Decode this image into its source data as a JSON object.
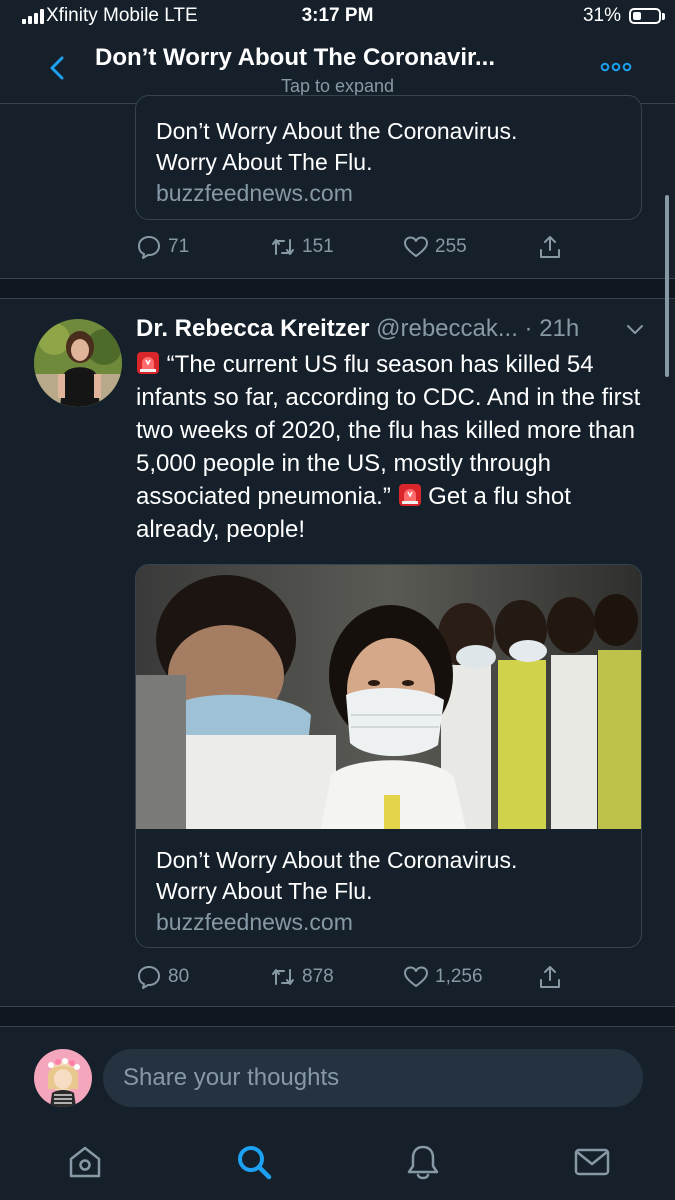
{
  "status_bar": {
    "carrier": "Xfinity Mobile  LTE",
    "time": "3:17 PM",
    "battery": "31%",
    "battery_level": 0.31
  },
  "header": {
    "title": "Don’t Worry About The Coronavir...",
    "subtitle": "Tap to expand",
    "back_icon": "chevron-left-icon",
    "more_icon": "more-dots-icon"
  },
  "top_tweet": {
    "card": {
      "title_line1": "Don’t Worry About the Coronavirus.",
      "title_line2": "Worry About The Flu.",
      "domain": "buzzfeednews.com"
    },
    "actions": {
      "replies": "71",
      "retweets": "151",
      "likes": "255"
    }
  },
  "tweet": {
    "author": "Dr. Rebecca Kreitzer",
    "handle": "@rebeccak...",
    "time": "· 21h",
    "text_part1": "“The current US flu season has killed 54 infants so far, according to CDC. And in the first two weeks of 2020, the flu has killed more than 5,000 people in the US, mostly through associated pneumonia.”",
    "text_part2": "Get a flu shot already, people!",
    "card": {
      "title_line1": "Don’t Worry About the Coronavirus.",
      "title_line2": "Worry About The Flu.",
      "domain": "buzzfeednews.com"
    },
    "actions": {
      "replies": "80",
      "retweets": "878",
      "likes": "1,256"
    }
  },
  "composer": {
    "placeholder": "Share your thoughts"
  },
  "tabs": [
    "home-icon",
    "search-icon",
    "bell-icon",
    "mail-icon"
  ],
  "colors": {
    "background": "#15202b",
    "accent": "#1da1f2",
    "muted": "#8899a6",
    "divider": "#38444d"
  }
}
